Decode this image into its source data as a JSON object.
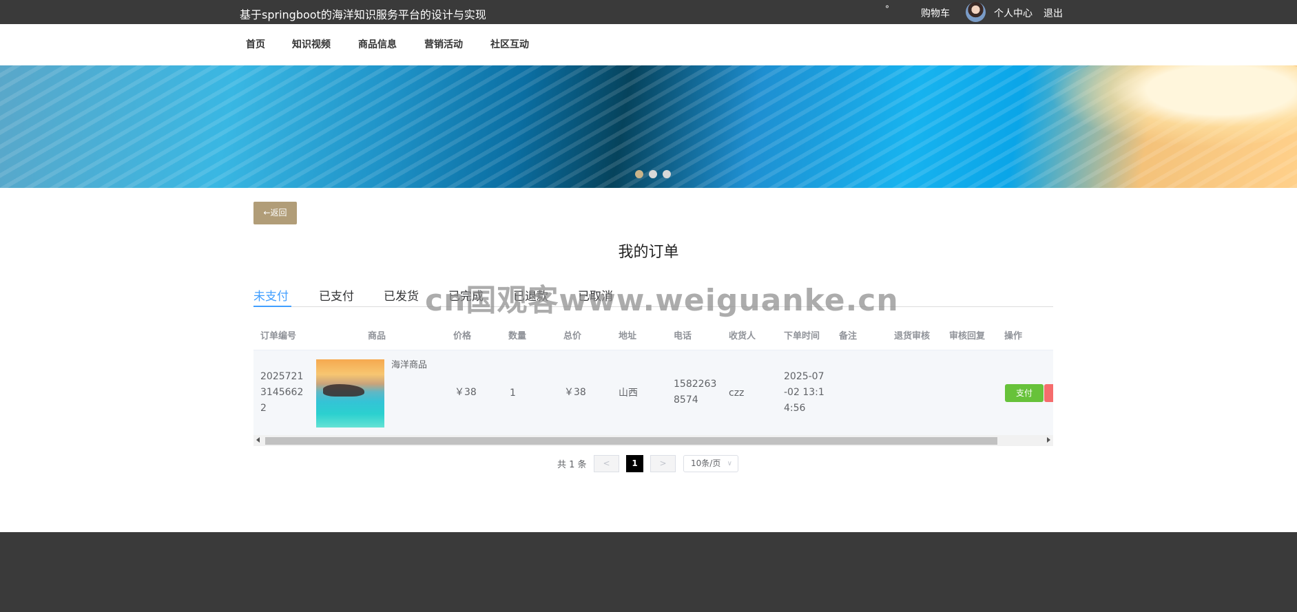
{
  "header": {
    "site_title": "基于springboot的海洋知识服务平台的设计与实现",
    "dot": "°",
    "cart": "购物车",
    "user_center": "个人中心",
    "logout": "退出"
  },
  "nav": {
    "items": [
      "首页",
      "知识视频",
      "商品信息",
      "营销活动",
      "社区互动"
    ]
  },
  "banner": {
    "slide_count": 3,
    "active_slide": 1
  },
  "back_button": "←返回",
  "page_title": "我的订单",
  "tabs": [
    "未支付",
    "已支付",
    "已发货",
    "已完成",
    "已退款",
    "已取消"
  ],
  "active_tab": "未支付",
  "table": {
    "columns": [
      "订单编号",
      "商品",
      "价格",
      "数量",
      "总价",
      "地址",
      "电话",
      "收货人",
      "下单时间",
      "备注",
      "退货审核",
      "审核回复",
      "操作"
    ],
    "rows": [
      {
        "order_no": [
          "2025721",
          "3145662",
          "2"
        ],
        "goods_name": "海洋商品",
        "price": "￥38",
        "quantity": "1",
        "total": "￥38",
        "address": "山西",
        "phone": [
          "1582263",
          "8574"
        ],
        "receiver": "czz",
        "order_time": [
          "2025-07",
          "-02 13:1",
          "4:56"
        ],
        "remark": "",
        "return_review": "",
        "review_reply": "",
        "pay_label": "支付"
      }
    ]
  },
  "pagination": {
    "total_text": "共 1 条",
    "prev": "<",
    "current_page": "1",
    "next": ">",
    "page_size": "10条/页"
  },
  "watermark": "cn国观客www.weiguanke.cn"
}
